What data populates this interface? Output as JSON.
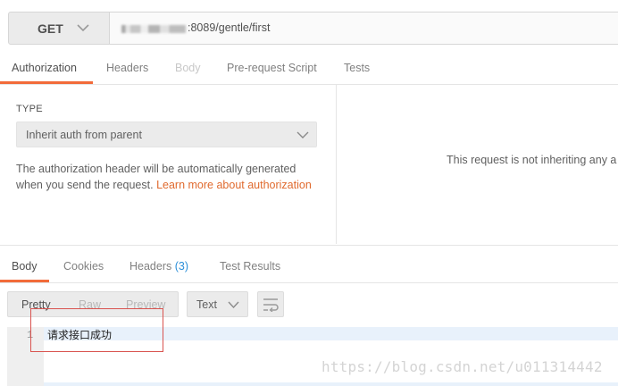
{
  "request": {
    "method": "GET",
    "url_visible": ":8089/gentle/first"
  },
  "request_tabs": [
    {
      "label": "Authorization",
      "state": "active"
    },
    {
      "label": "Headers",
      "state": "normal"
    },
    {
      "label": "Body",
      "state": "disabled"
    },
    {
      "label": "Pre-request Script",
      "state": "normal"
    },
    {
      "label": "Tests",
      "state": "normal"
    }
  ],
  "auth": {
    "type_label": "TYPE",
    "type_value": "Inherit auth from parent",
    "description": "The authorization header will be automatically generated when you send the request. ",
    "learn_more_link": "Learn more about authorization",
    "right_message": "This request is not inheriting any a"
  },
  "response_tabs": [
    {
      "label": "Body",
      "state": "active"
    },
    {
      "label": "Cookies",
      "state": "normal"
    },
    {
      "label": "Headers",
      "count": "(3)",
      "state": "normal"
    },
    {
      "label": "Test Results",
      "state": "normal"
    }
  ],
  "response_view": {
    "modes": [
      "Pretty",
      "Raw",
      "Preview"
    ],
    "active_mode": "Pretty",
    "format": "Text"
  },
  "response_body": {
    "line_number": "1",
    "text": "请求接口成功"
  },
  "watermark": "https://blog.csdn.net/u011314442",
  "colors": {
    "accent": "#f26b3a",
    "link": "#e06a2e",
    "count": "#2a8ed8",
    "annotation_box": "#d9534f"
  }
}
